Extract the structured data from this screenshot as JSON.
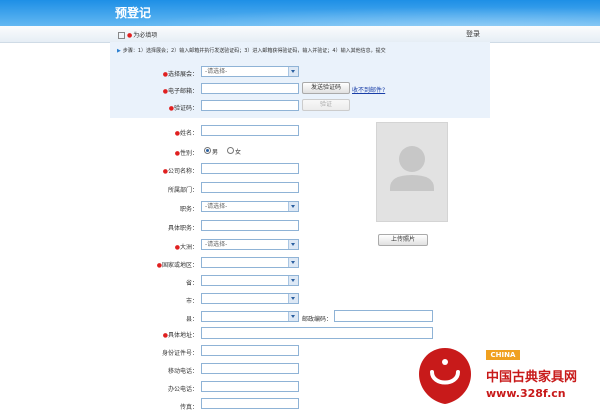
{
  "header": {
    "title": "预登记"
  },
  "topbar": {
    "required_note": "为必填项",
    "login": "登录"
  },
  "steps": {
    "text": "步骤：1）选择展会；2）输入邮箱并执行发送验证码；3）进入邮箱获得验证码，输入并验证；4）输入其他信息，提交"
  },
  "form": {
    "exhibition": {
      "label": "选择展会：",
      "placeholder": "-请选择-"
    },
    "email": {
      "label": "电子邮箱：",
      "send_button": "发送验证码",
      "not_received": "收不到邮件?"
    },
    "code": {
      "label": "验证码：",
      "verify_button": "验证"
    },
    "name": {
      "label": "姓名："
    },
    "gender": {
      "label": "性别：",
      "options": [
        "男",
        "女"
      ],
      "selected": "男"
    },
    "company": {
      "label": "公司名称："
    },
    "department": {
      "label": "所属部门："
    },
    "position": {
      "label": "职务：",
      "placeholder": "-请选择-"
    },
    "position_detail": {
      "label": "具体职务："
    },
    "continent": {
      "label": "大洲：",
      "placeholder": "-请选择-"
    },
    "country": {
      "label": "国家或地区："
    },
    "province": {
      "label": "省："
    },
    "city": {
      "label": "市："
    },
    "county": {
      "label": "县："
    },
    "zipcode": {
      "label": "邮政编码："
    },
    "address": {
      "label": "具体地址："
    },
    "id_number": {
      "label": "身份证件号："
    },
    "mobile": {
      "label": "移动电话："
    },
    "office_phone": {
      "label": "办公电话："
    },
    "fax": {
      "label": "传真："
    },
    "upload_photo": "上传照片"
  },
  "watermark": {
    "badge": "CHINA",
    "name": "中国古典家具网",
    "url": "www.328f.cn"
  },
  "colors": {
    "header_blue": "#1e8fe6",
    "required_red": "#e02020",
    "link_blue": "#1a3fa8",
    "watermark_red": "#c81a1a"
  }
}
